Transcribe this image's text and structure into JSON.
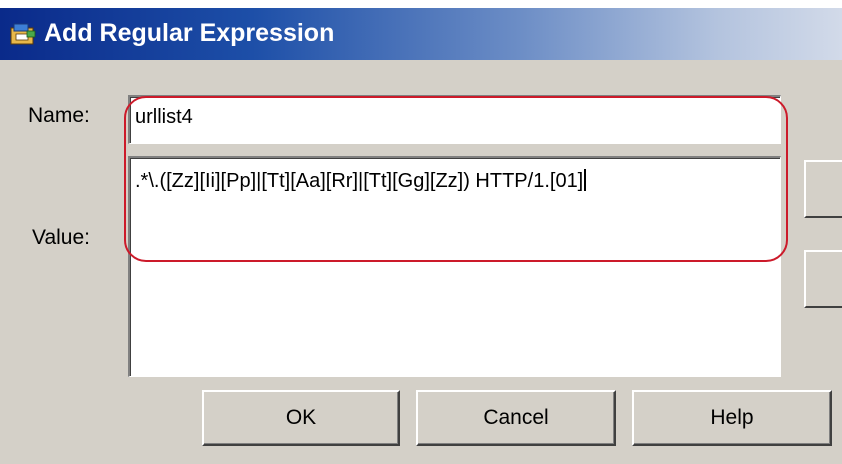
{
  "window": {
    "title": "Add Regular Expression",
    "icon": "app-icon"
  },
  "form": {
    "name_label": "Name:",
    "name_value": "urllist4",
    "value_label": "Value:",
    "value_text": ".*\\.([Zz][Ii][Pp]|[Tt][Aa][Rr]|[Tt][Gg][Zz]) HTTP/1.[01]"
  },
  "buttons": {
    "ok": "OK",
    "cancel": "Cancel",
    "help": "Help"
  },
  "colors": {
    "highlight_outline": "#cc1a2a",
    "titlebar_start": "#0a2a8a",
    "titlebar_end": "#d2dae9",
    "dialog_bg": "#d4d0c8"
  }
}
